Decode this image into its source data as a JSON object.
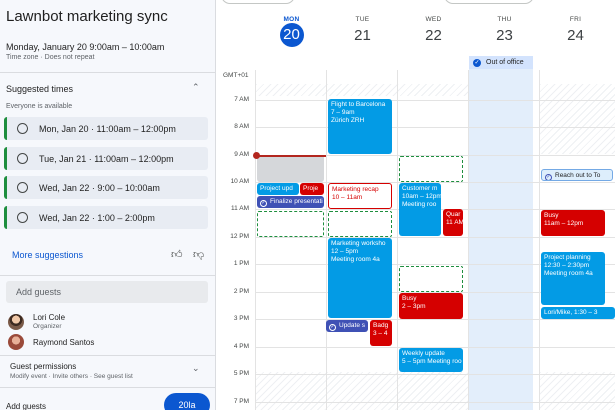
{
  "event": {
    "title": "Lawnbot marketing sync",
    "when": "Monday, January 20   9:00am  –  10:00am",
    "timezone": "Time zone · Does not repeat"
  },
  "suggested": {
    "heading": "Suggested times",
    "subheading": "Everyone is available",
    "times": [
      "Mon, Jan 20 · 11:00am – 12:00pm",
      "Tue, Jan 21 · 11:00am – 12:00pm",
      "Wed, Jan 22 · 9:00 – 10:00am",
      "Wed, Jan 22 · 1:00 – 2:00pm"
    ],
    "more_label": "More suggestions"
  },
  "guests": {
    "placeholder": "Add guests",
    "list": [
      {
        "name": "Lori Cole",
        "role": "Organizer"
      },
      {
        "name": "Raymond Santos",
        "role": ""
      }
    ]
  },
  "permissions": {
    "title": "Guest permissions",
    "detail": "Modify event · Invite others · See guest list"
  },
  "footer": {
    "label": "Add guests",
    "button": "20la"
  },
  "calendar": {
    "tz_label": "GMT+01",
    "days": [
      {
        "dow": "MON",
        "num": "20"
      },
      {
        "dow": "TUE",
        "num": "21"
      },
      {
        "dow": "WED",
        "num": "22"
      },
      {
        "dow": "THU",
        "num": "23"
      },
      {
        "dow": "FRI",
        "num": "24"
      }
    ],
    "hours": [
      "7 AM",
      "8 AM",
      "9 AM",
      "10 AM",
      "11 AM",
      "12 PM",
      "1 PM",
      "2 PM",
      "3 PM",
      "4 PM",
      "5 PM",
      "7 PM"
    ],
    "out_of_office": "Out of office",
    "events": {
      "mon_project": "Project upd",
      "mon_proje": "Proje",
      "mon_finalize": "Finalize presentati",
      "mon_update": "Update s",
      "mon_badge": "Badg",
      "mon_badge_time": "3 – 4",
      "tue_flight_title": "Flight to Barcelona",
      "tue_flight_time": "7 – 9am",
      "tue_flight_loc": "Zürich ZRH",
      "tue_recap_title": "Marketing recap",
      "tue_recap_time": "10 – 11am",
      "tue_workshop_title": "Marketing worksho",
      "tue_workshop_time": "12 – 5pm",
      "tue_workshop_loc": "Meeting room 4a",
      "wed_customer_title": "Customer m",
      "wed_customer_time": "10am – 12pm",
      "wed_customer_loc": "Meeting roo",
      "wed_quar": "Quar",
      "wed_quar_time": "11 AM",
      "wed_busy_title": "Busy",
      "wed_busy_time": "2 – 3pm",
      "wed_weekly_title": "Weekly update",
      "wed_weekly_time": "5 – 5pm  Meeting roo",
      "fri_reach": "Reach out to To",
      "fri_busy_title": "Busy",
      "fri_busy_time": "11am – 12pm",
      "fri_planning_title": "Project planning",
      "fri_planning_time": "12:30 – 2:30pm",
      "fri_planning_loc": "Meeting room 4a",
      "fri_lori": "Lori/Mike, 1:30 – 3"
    }
  },
  "colors": {
    "accent": "#0b57d0",
    "suggestion_bar": "#1e8e3e",
    "event_blue": "#039be5",
    "event_red": "#d50000"
  }
}
